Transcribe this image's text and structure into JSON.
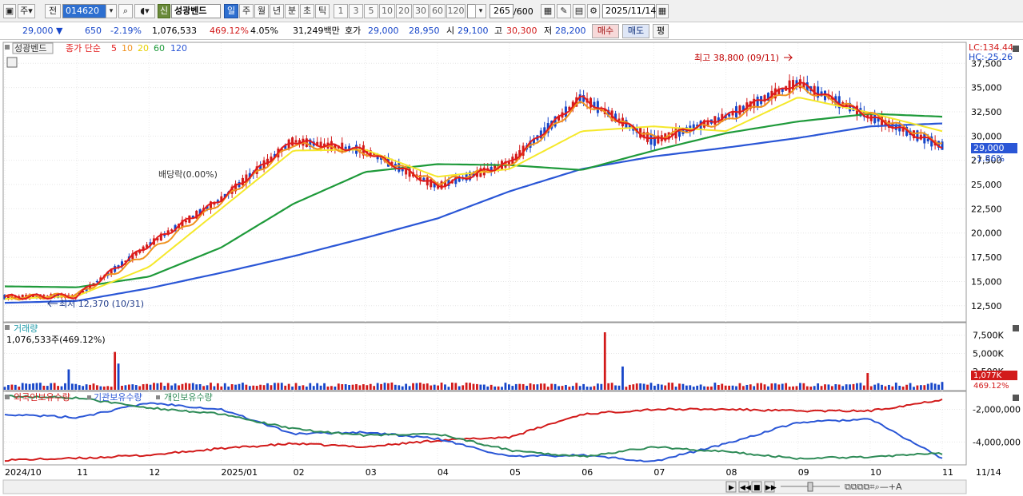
{
  "toolbar": {
    "code_mode": "주",
    "prev_label": "전",
    "stock_code": "014620",
    "new_badge": "신",
    "stock_name": "성광벤드",
    "periods": [
      "일",
      "주",
      "월",
      "년",
      "분",
      "초",
      "틱"
    ],
    "active_period": "일",
    "intervals": [
      "1",
      "3",
      "5",
      "10",
      "20",
      "30",
      "60",
      "120"
    ],
    "count_value": "265",
    "count_total": "/600",
    "date": "2025/11/14"
  },
  "quote": {
    "price": "29,000",
    "change": "650",
    "change_pct": "-2.19%",
    "volume": "1,076,533",
    "volume_ratio": "469.12%",
    "turnover_pct": "4.05%",
    "amount": "31,249백만",
    "bid_label": "호가",
    "bid1": "29,000",
    "bid2": "28,950",
    "open_label": "시",
    "open": "29,100",
    "high_label": "고",
    "high": "30,300",
    "low_label": "저",
    "low": "28,200",
    "buy_label": "매수",
    "sell_label": "매도",
    "eval_label": "평"
  },
  "price_panel": {
    "name_tag": "성광벤드",
    "legend_label": "종가 단순",
    "ma_labels": [
      "5",
      "10",
      "20",
      "60",
      "120"
    ],
    "lc_label": "LC:134.44",
    "hc_label": "HC:-25.26",
    "current_price": "29,000",
    "current_pct": "-1.86%",
    "max_annotation": "최고 38,800 (09/11)",
    "min_annotation": "최저 12,370 (10/31)",
    "dividend_annotation": "배당락(0.00%)",
    "y_ticks": [
      "37,500",
      "35,000",
      "32,500",
      "30,000",
      "27,500",
      "25,000",
      "22,500",
      "20,000",
      "17,500",
      "15,000",
      "12,500"
    ]
  },
  "volume_panel": {
    "title": "거래량",
    "value": "1,076,533주(469.12%)",
    "y_ticks": [
      "7,500K",
      "5,000K",
      "2,500K"
    ],
    "current_badge": "1,077K",
    "current_pct": "469.12%"
  },
  "holdings_panel": {
    "legend": [
      "외국인보유수량",
      "기관보유수량",
      "개인보유수량"
    ],
    "y_ticks": [
      "-2,000,000",
      "-4,000,000"
    ]
  },
  "x_axis": {
    "labels": [
      "2024/10",
      "11",
      "12",
      "2025/01",
      "02",
      "03",
      "04",
      "05",
      "06",
      "07",
      "08",
      "09",
      "10",
      "11"
    ],
    "end_date": "11/14"
  },
  "colors": {
    "ma5": "#e21b1b",
    "ma10": "#f0921e",
    "ma20": "#f5e82a",
    "ma60": "#1e9a3a",
    "ma120": "#2a56d6",
    "up": "#d21a1a",
    "down": "#1746c9",
    "foreign": "#d21a1a",
    "institution": "#2a56d6",
    "individual": "#2e8b57"
  },
  "chart_data": {
    "type": "line",
    "x": [
      "2024/10",
      "11",
      "12",
      "2025/01",
      "02",
      "03",
      "04",
      "05",
      "06",
      "07",
      "08",
      "09",
      "10",
      "11"
    ],
    "series": [
      {
        "name": "5",
        "values": [
          13400,
          13500,
          18800,
          23500,
          29500,
          28500,
          24800,
          27200,
          34000,
          29500,
          32000,
          35500,
          32000,
          29000
        ]
      },
      {
        "name": "10",
        "values": [
          13300,
          13600,
          18000,
          23200,
          29200,
          28300,
          25200,
          27000,
          33500,
          29800,
          31500,
          35000,
          32300,
          29300
        ]
      },
      {
        "name": "20",
        "values": [
          13200,
          13500,
          16500,
          22500,
          28500,
          28600,
          25800,
          26600,
          30500,
          31000,
          30500,
          34000,
          32400,
          30500
        ]
      },
      {
        "name": "60",
        "values": [
          14500,
          14400,
          15500,
          18500,
          23000,
          26300,
          27100,
          27000,
          26500,
          28500,
          30300,
          31500,
          32300,
          32000
        ]
      },
      {
        "name": "120",
        "values": [
          12800,
          13000,
          14300,
          15900,
          17600,
          19500,
          21500,
          24300,
          26600,
          27900,
          28800,
          29800,
          31000,
          31300
        ]
      }
    ],
    "ylim": [
      11000,
      39500
    ]
  }
}
